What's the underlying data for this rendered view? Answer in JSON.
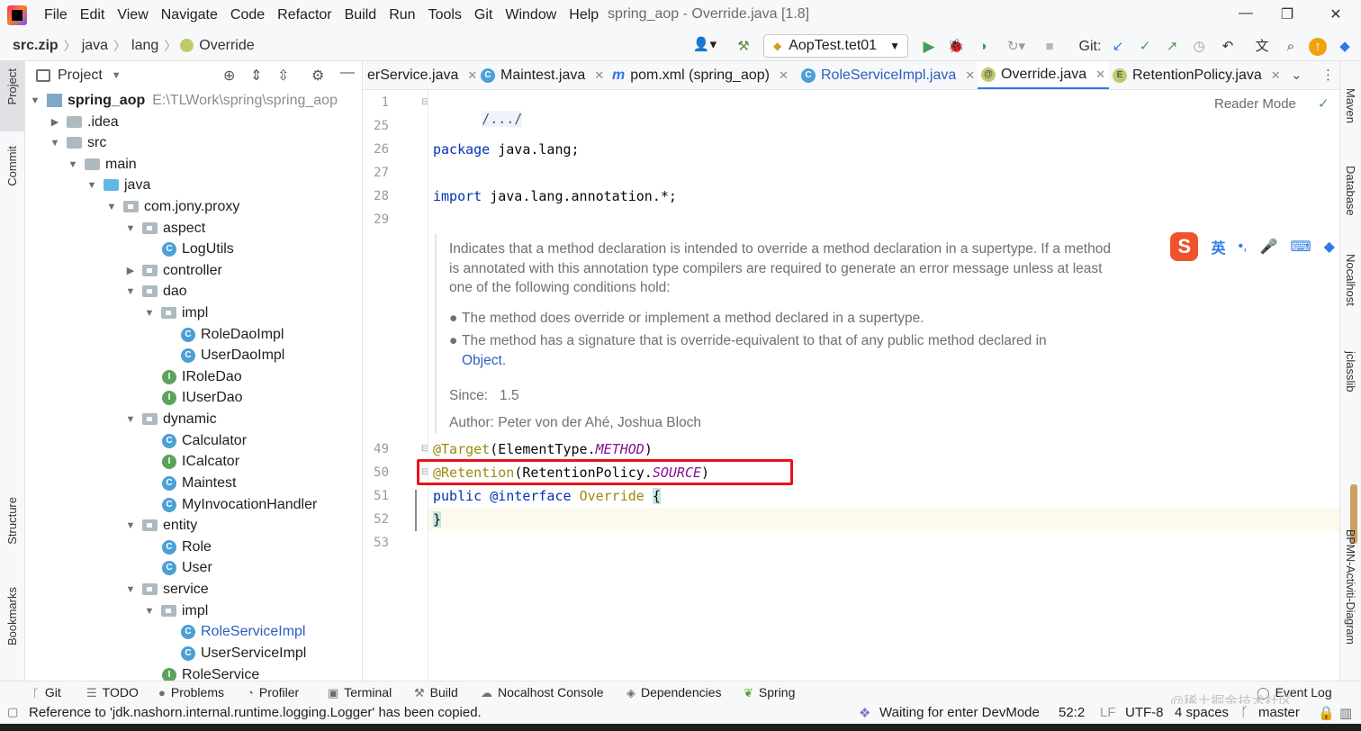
{
  "menu": {
    "items": [
      "File",
      "Edit",
      "View",
      "Navigate",
      "Code",
      "Refactor",
      "Build",
      "Run",
      "Tools",
      "Git",
      "Window",
      "Help"
    ],
    "window_title": "spring_aop - Override.java [1.8]"
  },
  "breadcrumb": {
    "items": [
      "src.zip",
      "java",
      "lang",
      "Override"
    ]
  },
  "run_config": {
    "label": "AopTest.tet01"
  },
  "git_label": "Git:",
  "project_panel": {
    "title": "Project",
    "tree": [
      {
        "label": "spring_aop",
        "path": "E:\\TLWork\\spring\\spring_aop"
      },
      {
        "label": ".idea"
      },
      {
        "label": "src"
      },
      {
        "label": "main"
      },
      {
        "label": "java"
      },
      {
        "label": "com.jony.proxy"
      },
      {
        "label": "aspect"
      },
      {
        "label": "LogUtils"
      },
      {
        "label": "controller"
      },
      {
        "label": "dao"
      },
      {
        "label": "impl"
      },
      {
        "label": "RoleDaoImpl"
      },
      {
        "label": "UserDaoImpl"
      },
      {
        "label": "IRoleDao"
      },
      {
        "label": "IUserDao"
      },
      {
        "label": "dynamic"
      },
      {
        "label": "Calculator"
      },
      {
        "label": "ICalcator"
      },
      {
        "label": "Maintest"
      },
      {
        "label": "MyInvocationHandler"
      },
      {
        "label": "entity"
      },
      {
        "label": "Role"
      },
      {
        "label": "User"
      },
      {
        "label": "service"
      },
      {
        "label": "impl"
      },
      {
        "label": "RoleServiceImpl"
      },
      {
        "label": "UserServiceImpl"
      },
      {
        "label": "RoleService"
      }
    ]
  },
  "left_stripe": {
    "project": "Project",
    "commit": "Commit",
    "structure": "Structure",
    "bookmarks": "Bookmarks"
  },
  "tabs": [
    {
      "label": "erService.java"
    },
    {
      "label": "Maintest.java"
    },
    {
      "label": "pom.xml (spring_aop)"
    },
    {
      "label": "RoleServiceImpl.java"
    },
    {
      "label": "Override.java"
    },
    {
      "label": "RetentionPolicy.java"
    }
  ],
  "editor": {
    "reader_mode": "Reader Mode",
    "line_numbers": [
      "1",
      "25",
      "26",
      "27",
      "28",
      "29",
      "49",
      "50",
      "51",
      "52",
      "53"
    ],
    "folded": "/.../",
    "pkg_kw": "package",
    "pkg_name": " java.lang;",
    "imp_kw": "import",
    "imp_name": " java.lang.annotation.*;",
    "doc": {
      "intro": "Indicates that a method declaration is intended to override a method declaration in a supertype. If a method is annotated with this annotation type compilers are required to generate an error message unless at least one of the following conditions hold:",
      "bullet1": "The method does override or implement a method declared in a supertype.",
      "bullet2": "The method has a signature that is override-equivalent to that of any public method declared in",
      "bullet2_link": "Object",
      "bullet2_end": ".",
      "since_label": "Since:",
      "since_value": "1.5",
      "author_label": "Author:",
      "author_value": "Peter von der Ahé, Joshua Bloch"
    },
    "l49_ann": "@Target",
    "l49_a": "(ElementType.",
    "l49_b": "METHOD",
    "l49_c": ")",
    "l50_ann": "@Retention",
    "l50_a": "(RetentionPolicy.",
    "l50_b": "SOURCE",
    "l50_c": ")",
    "l51_kw": "public",
    "l51_kw2": " @interface ",
    "l51_name": "Override",
    "l51_brace": "{",
    "l52_brace": "}"
  },
  "ime": {
    "lang": "英"
  },
  "right_stripe": {
    "maven": "Maven",
    "database": "Database",
    "nocalhost": "Nocalhost",
    "jclasslib": "jclasslib",
    "bpmn": "BPMN-Activiti-Diagram"
  },
  "bottom_tools": [
    {
      "label": "Git"
    },
    {
      "label": "TODO"
    },
    {
      "label": "Problems"
    },
    {
      "label": "Profiler"
    },
    {
      "label": "Terminal"
    },
    {
      "label": "Build"
    },
    {
      "label": "Nocalhost Console"
    },
    {
      "label": "Dependencies"
    },
    {
      "label": "Spring"
    },
    {
      "label": "Event Log"
    }
  ],
  "status": {
    "message": "Reference to 'jdk.nashorn.internal.runtime.logging.Logger' has been copied.",
    "devmode": "Waiting for enter DevMode",
    "position": "52:2",
    "line_sep": "LF",
    "encoding": "UTF-8",
    "indent": "4 spaces",
    "branch": "master"
  },
  "watermark": "@稀土掘金技术社区"
}
